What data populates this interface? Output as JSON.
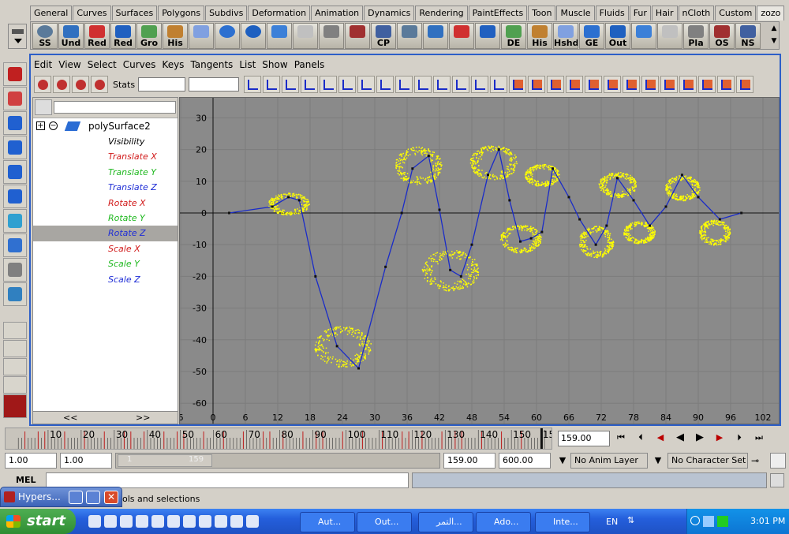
{
  "shelf_tabs": [
    "General",
    "Curves",
    "Surfaces",
    "Polygons",
    "Subdivs",
    "Deformation",
    "Animation",
    "Dynamics",
    "Rendering",
    "PaintEffects",
    "Toon",
    "Muscle",
    "Fluids",
    "Fur",
    "Hair",
    "nCloth",
    "Custom",
    "zozo"
  ],
  "shelf_buttons": [
    {
      "label": "SS",
      "icon": "sphere-icon"
    },
    {
      "label": "Und",
      "icon": "undo-icon"
    },
    {
      "label": "Red",
      "icon": "redo-icon"
    },
    {
      "label": "Red",
      "icon": "redo-icon"
    },
    {
      "label": "Gro",
      "icon": "group-icon"
    },
    {
      "label": "His",
      "icon": "history-icon"
    },
    {
      "label": "",
      "icon": "plane-icon"
    },
    {
      "label": "",
      "icon": "sphere-icon"
    },
    {
      "label": "",
      "icon": "sphere-icon"
    },
    {
      "label": "",
      "icon": "cube-icon"
    },
    {
      "label": "",
      "icon": "cylinder-icon"
    },
    {
      "label": "",
      "icon": "cone-icon"
    },
    {
      "label": "",
      "icon": "torus-icon"
    },
    {
      "label": "CP",
      "icon": "center-pivot-icon"
    },
    {
      "label": "",
      "icon": "grid-icon"
    },
    {
      "label": "",
      "icon": "uv-icon"
    },
    {
      "label": "",
      "icon": "scissors-icon"
    },
    {
      "label": "",
      "icon": "select-icon"
    },
    {
      "label": "DE",
      "icon": "delete-edge-icon"
    },
    {
      "label": "His",
      "icon": "history-icon"
    },
    {
      "label": "Hshd",
      "icon": "hypershade-icon"
    },
    {
      "label": "GE",
      "icon": "graph-editor-icon"
    },
    {
      "label": "Out",
      "icon": "outliner-icon"
    },
    {
      "label": "",
      "icon": "mel-icon"
    },
    {
      "label": "",
      "icon": "mel-icon"
    },
    {
      "label": "Pla",
      "icon": "playblast-icon"
    },
    {
      "label": "OS",
      "icon": "os-icon"
    },
    {
      "label": "NS",
      "icon": "ns-icon"
    }
  ],
  "ge_menu": [
    "Edit",
    "View",
    "Select",
    "Curves",
    "Keys",
    "Tangents",
    "List",
    "Show",
    "Panels"
  ],
  "stats_label": "Stats",
  "outliner": {
    "object": "polySurface2",
    "channels": [
      {
        "label": "Visibility",
        "color": "#000000"
      },
      {
        "label": "Translate X",
        "color": "#d11a1a"
      },
      {
        "label": "Translate Y",
        "color": "#1fb81f"
      },
      {
        "label": "Translate Z",
        "color": "#1f2ed6"
      },
      {
        "label": "Rotate X",
        "color": "#d11a1a"
      },
      {
        "label": "Rotate Y",
        "color": "#1fb81f"
      },
      {
        "label": "Rotate Z",
        "color": "#1f2ed6"
      },
      {
        "label": "Scale X",
        "color": "#d11a1a"
      },
      {
        "label": "Scale Y",
        "color": "#1fb81f"
      },
      {
        "label": "Scale Z",
        "color": "#1f2ed6"
      }
    ],
    "selected_index": 6,
    "nav_prev": "<<",
    "nav_next": ">>"
  },
  "chart_data": {
    "type": "line",
    "x_ticks": [
      "6",
      "0",
      "6",
      "12",
      "18",
      "24",
      "30",
      "36",
      "42",
      "48",
      "54",
      "60",
      "66",
      "72",
      "78",
      "84",
      "90",
      "96",
      "102"
    ],
    "y_ticks": [
      "30",
      "20",
      "10",
      "0",
      "-10",
      "-20",
      "-30",
      "-40",
      "-50",
      "-60"
    ],
    "xlim": [
      -6,
      104
    ],
    "ylim": [
      -62,
      35
    ],
    "series": [
      {
        "keys_x": [
          3,
          11,
          14,
          16,
          19,
          23,
          27,
          32,
          35,
          37,
          40,
          42,
          44,
          46,
          48,
          51,
          53,
          55,
          57,
          59,
          61,
          63,
          66,
          68,
          71,
          73,
          75,
          78,
          81,
          84,
          87,
          90,
          94,
          98
        ],
        "keys_y": [
          0,
          2,
          5,
          4,
          -20,
          -42,
          -49,
          -17,
          0,
          14,
          18,
          1,
          -18,
          -20,
          -10,
          12,
          20,
          4,
          -9,
          -8,
          -6,
          14,
          5,
          -2,
          -10,
          -4,
          11,
          4,
          -4,
          2,
          12,
          5,
          -2,
          0
        ],
        "color": "#1a2cc8"
      }
    ],
    "scatter_color": "#ffff00"
  },
  "timeline": {
    "labels": [
      "10",
      "20",
      "30",
      "40",
      "50",
      "60",
      "70",
      "80",
      "90",
      "100",
      "110",
      "120",
      "130",
      "140",
      "150",
      "159"
    ],
    "current_frame": "159.00"
  },
  "range": {
    "start": "1.00",
    "playback_start": "1.00",
    "slider_left": "1",
    "slider_right": "159",
    "end": "159.00",
    "total_end": "600.00",
    "anim_layer": "No Anim Layer",
    "character_set": "No Character Set"
  },
  "mel": {
    "label": "MEL"
  },
  "help_text": "ols and selections",
  "hypershade_window": "Hypers...",
  "taskbar": {
    "start": "start",
    "tasks": [
      "Aut...",
      "Out...",
      "التمر...",
      "Ado...",
      "Inte..."
    ],
    "language": "EN",
    "time": "3:01 PM"
  }
}
